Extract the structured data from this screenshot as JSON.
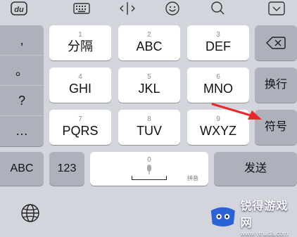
{
  "toolbar": {
    "icons": [
      "baidu-logo-icon",
      "keyboard-icon",
      "cursor-move-icon",
      "emoji-icon",
      "search-icon",
      "collapse-keyboard-icon"
    ],
    "logo_text": "du"
  },
  "punctuation": [
    ",",
    "。",
    "?",
    "…"
  ],
  "keys": {
    "k1": {
      "num": "1",
      "label": "分隔"
    },
    "k2": {
      "num": "2",
      "label": "ABC"
    },
    "k3": {
      "num": "3",
      "label": "DEF"
    },
    "k4": {
      "num": "4",
      "label": "GHI"
    },
    "k5": {
      "num": "5",
      "label": "JKL"
    },
    "k6": {
      "num": "6",
      "label": "MNO"
    },
    "k7": {
      "num": "7",
      "label": "PQRS"
    },
    "k8": {
      "num": "8",
      "label": "TUV"
    },
    "k9": {
      "num": "9",
      "label": "WXYZ"
    },
    "k0": {
      "num": "0"
    }
  },
  "side": {
    "newline_label": "换行",
    "symbol_label": "符号",
    "delete_icon": "backspace-icon"
  },
  "bottom": {
    "abc_label": "ABC",
    "num_label": "123",
    "space_tag": "拼音",
    "send_label": "发送",
    "globe_icon": "globe-icon"
  },
  "watermark": {
    "title": "锐得游戏网",
    "url": "www.ytruida.com"
  },
  "colors": {
    "keyboard_bg": "#d3d5dc",
    "key_white": "#ffffff",
    "key_gray": "#acb1bb",
    "arrow_red": "#e8282a"
  }
}
